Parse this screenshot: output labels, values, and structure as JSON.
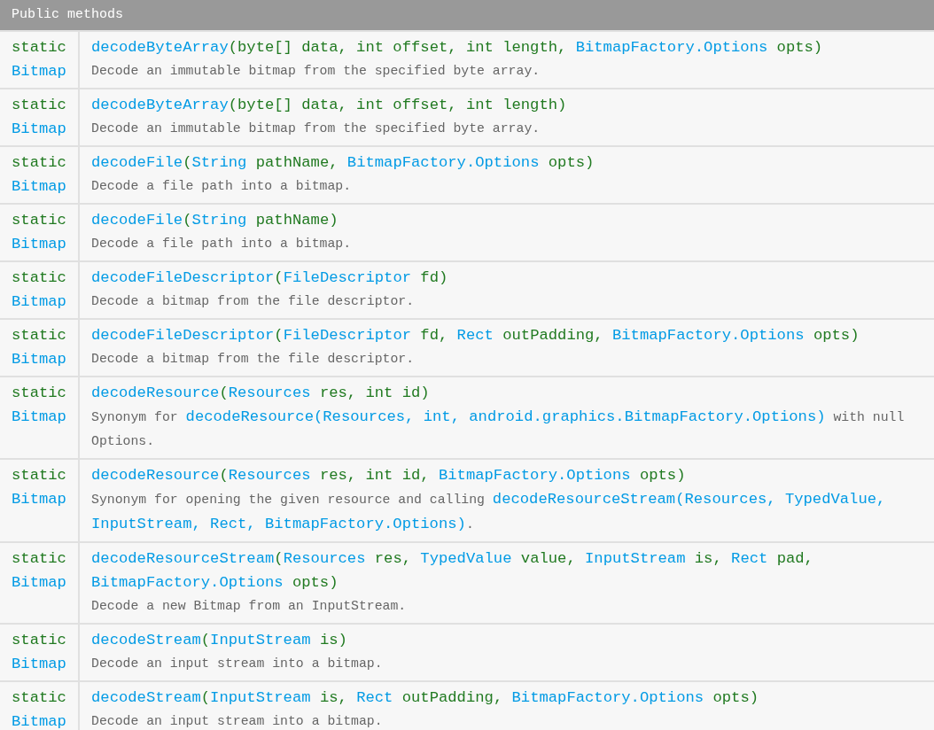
{
  "section_title": "Public methods",
  "methods": [
    {
      "modifier": "static",
      "return_type": "Bitmap",
      "signature": [
        {
          "kind": "link",
          "text": "decodeByteArray"
        },
        {
          "kind": "code",
          "text": "(byte[] data, int offset, int length, "
        },
        {
          "kind": "link",
          "text": "BitmapFactory.Options"
        },
        {
          "kind": "code",
          "text": " opts)"
        }
      ],
      "description": [
        {
          "kind": "text",
          "text": "Decode an immutable bitmap from the specified byte array."
        }
      ]
    },
    {
      "modifier": "static",
      "return_type": "Bitmap",
      "signature": [
        {
          "kind": "link",
          "text": "decodeByteArray"
        },
        {
          "kind": "code",
          "text": "(byte[] data, int offset, int length)"
        }
      ],
      "description": [
        {
          "kind": "text",
          "text": "Decode an immutable bitmap from the specified byte array."
        }
      ]
    },
    {
      "modifier": "static",
      "return_type": "Bitmap",
      "signature": [
        {
          "kind": "link",
          "text": "decodeFile"
        },
        {
          "kind": "code",
          "text": "("
        },
        {
          "kind": "link",
          "text": "String"
        },
        {
          "kind": "code",
          "text": " pathName, "
        },
        {
          "kind": "link",
          "text": "BitmapFactory.Options"
        },
        {
          "kind": "code",
          "text": " opts)"
        }
      ],
      "description": [
        {
          "kind": "text",
          "text": "Decode a file path into a bitmap."
        }
      ]
    },
    {
      "modifier": "static",
      "return_type": "Bitmap",
      "signature": [
        {
          "kind": "link",
          "text": "decodeFile"
        },
        {
          "kind": "code",
          "text": "("
        },
        {
          "kind": "link",
          "text": "String"
        },
        {
          "kind": "code",
          "text": " pathName)"
        }
      ],
      "description": [
        {
          "kind": "text",
          "text": "Decode a file path into a bitmap."
        }
      ]
    },
    {
      "modifier": "static",
      "return_type": "Bitmap",
      "signature": [
        {
          "kind": "link",
          "text": "decodeFileDescriptor"
        },
        {
          "kind": "code",
          "text": "("
        },
        {
          "kind": "link",
          "text": "FileDescriptor"
        },
        {
          "kind": "code",
          "text": " fd)"
        }
      ],
      "description": [
        {
          "kind": "text",
          "text": "Decode a bitmap from the file descriptor."
        }
      ]
    },
    {
      "modifier": "static",
      "return_type": "Bitmap",
      "signature": [
        {
          "kind": "link",
          "text": "decodeFileDescriptor"
        },
        {
          "kind": "code",
          "text": "("
        },
        {
          "kind": "link",
          "text": "FileDescriptor"
        },
        {
          "kind": "code",
          "text": " fd, "
        },
        {
          "kind": "link",
          "text": "Rect"
        },
        {
          "kind": "code",
          "text": " outPadding, "
        },
        {
          "kind": "link",
          "text": "BitmapFactory.Options"
        },
        {
          "kind": "code",
          "text": " opts)"
        }
      ],
      "description": [
        {
          "kind": "text",
          "text": "Decode a bitmap from the file descriptor."
        }
      ]
    },
    {
      "modifier": "static",
      "return_type": "Bitmap",
      "signature": [
        {
          "kind": "link",
          "text": "decodeResource"
        },
        {
          "kind": "code",
          "text": "("
        },
        {
          "kind": "link",
          "text": "Resources"
        },
        {
          "kind": "code",
          "text": " res, int id)"
        }
      ],
      "description": [
        {
          "kind": "text",
          "text": "Synonym for "
        },
        {
          "kind": "link",
          "text": "decodeResource(Resources, int, android.graphics.BitmapFactory.Options)"
        },
        {
          "kind": "text",
          "text": " with null Options."
        }
      ]
    },
    {
      "modifier": "static",
      "return_type": "Bitmap",
      "signature": [
        {
          "kind": "link",
          "text": "decodeResource"
        },
        {
          "kind": "code",
          "text": "("
        },
        {
          "kind": "link",
          "text": "Resources"
        },
        {
          "kind": "code",
          "text": " res, int id, "
        },
        {
          "kind": "link",
          "text": "BitmapFactory.Options"
        },
        {
          "kind": "code",
          "text": " opts)"
        }
      ],
      "description": [
        {
          "kind": "text",
          "text": "Synonym for opening the given resource and calling "
        },
        {
          "kind": "link",
          "text": "decodeResourceStream(Resources, TypedValue,"
        },
        {
          "kind": "link",
          "text": "InputStream, Rect, BitmapFactory.Options)"
        },
        {
          "kind": "text",
          "text": "."
        }
      ]
    },
    {
      "modifier": "static",
      "return_type": "Bitmap",
      "signature": [
        {
          "kind": "link",
          "text": "decodeResourceStream"
        },
        {
          "kind": "code",
          "text": "("
        },
        {
          "kind": "link",
          "text": "Resources"
        },
        {
          "kind": "code",
          "text": " res, "
        },
        {
          "kind": "link",
          "text": "TypedValue"
        },
        {
          "kind": "code",
          "text": " value, "
        },
        {
          "kind": "link",
          "text": "InputStream"
        },
        {
          "kind": "code",
          "text": " is, "
        },
        {
          "kind": "link",
          "text": "Rect"
        },
        {
          "kind": "code",
          "text": " pad, "
        },
        {
          "kind": "link",
          "text": "BitmapFactory.Options"
        },
        {
          "kind": "code",
          "text": " opts)"
        }
      ],
      "description": [
        {
          "kind": "text",
          "text": "Decode a new Bitmap from an InputStream."
        }
      ]
    },
    {
      "modifier": "static",
      "return_type": "Bitmap",
      "signature": [
        {
          "kind": "link",
          "text": "decodeStream"
        },
        {
          "kind": "code",
          "text": "("
        },
        {
          "kind": "link",
          "text": "InputStream"
        },
        {
          "kind": "code",
          "text": " is)"
        }
      ],
      "description": [
        {
          "kind": "text",
          "text": "Decode an input stream into a bitmap."
        }
      ]
    },
    {
      "modifier": "static",
      "return_type": "Bitmap",
      "signature": [
        {
          "kind": "link",
          "text": "decodeStream"
        },
        {
          "kind": "code",
          "text": "("
        },
        {
          "kind": "link",
          "text": "InputStream"
        },
        {
          "kind": "code",
          "text": " is, "
        },
        {
          "kind": "link",
          "text": "Rect"
        },
        {
          "kind": "code",
          "text": " outPadding, "
        },
        {
          "kind": "link",
          "text": "BitmapFactory.Options"
        },
        {
          "kind": "code",
          "text": " opts)"
        }
      ],
      "description": [
        {
          "kind": "text",
          "text": "Decode an input stream into a bitmap."
        }
      ]
    }
  ]
}
